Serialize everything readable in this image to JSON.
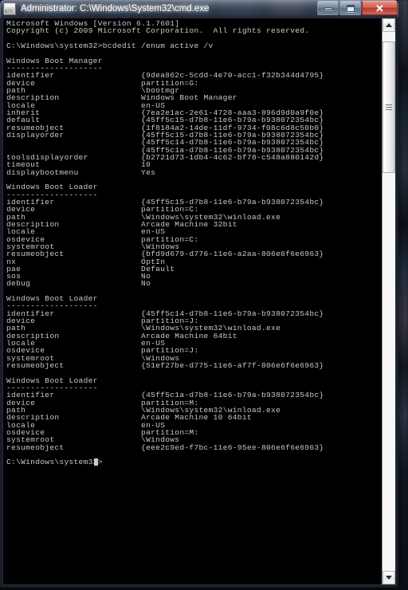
{
  "window": {
    "title": "Administrator: C:\\Windows\\System32\\cmd.exe",
    "icon": "cmd-console-icon",
    "buttons": {
      "minimize": "Minimize",
      "maximize": "Maximize",
      "close": "Close",
      "close_glyph": "✕"
    }
  },
  "colors": {
    "console_background": "#000000",
    "console_foreground": "#c8c8c8",
    "close_button": "#b53a2c",
    "title_text": "#ffffff"
  },
  "console": {
    "header_lines": [
      "Microsoft Windows [Version 6.1.7601]",
      "Copyright (c) 2009 Microsoft Corporation.  All rights reserved."
    ],
    "prompt": "C:\\Windows\\system32>",
    "command": "bcdedit /enum active /v",
    "trailing_prompt": "C:\\Windows\\system32>",
    "sections": [
      {
        "heading": "Windows Boot Manager",
        "underline": "--------------------",
        "entries": [
          {
            "key": "identifier",
            "values": [
              "{9dea862c-5cdd-4e70-acc1-f32b344d4795}"
            ]
          },
          {
            "key": "device",
            "values": [
              "partition=G:"
            ]
          },
          {
            "key": "path",
            "values": [
              "\\bootmgr"
            ]
          },
          {
            "key": "description",
            "values": [
              "Windows Boot Manager"
            ]
          },
          {
            "key": "locale",
            "values": [
              "en-US"
            ]
          },
          {
            "key": "inherit",
            "values": [
              "{7ea2e1ac-2e61-4728-aaa3-896d9d0a9f0e}"
            ]
          },
          {
            "key": "default",
            "values": [
              "{45ff5c15-d7b8-11e6-b79a-b938072354bc}"
            ]
          },
          {
            "key": "resumeobject",
            "values": [
              "{1f8184a2-14de-11df-9734-f08c6d8c50b0}"
            ]
          },
          {
            "key": "displayorder",
            "values": [
              "{45ff5c15-d7b8-11e6-b79a-b938072354bc}",
              "{45ff5c14-d7b8-11e6-b79a-b938072354bc}",
              "{45ff5c1a-d7b8-11e6-b79a-b938072354bc}"
            ]
          },
          {
            "key": "toolsdisplayorder",
            "values": [
              "{b2721d73-1db4-4c62-bf78-c548a880142d}"
            ]
          },
          {
            "key": "timeout",
            "values": [
              "10"
            ]
          },
          {
            "key": "displaybootmenu",
            "values": [
              "Yes"
            ]
          }
        ]
      },
      {
        "heading": "Windows Boot Loader",
        "underline": "-------------------",
        "entries": [
          {
            "key": "identifier",
            "values": [
              "{45ff5c15-d7b8-11e6-b79a-b938072354bc}"
            ]
          },
          {
            "key": "device",
            "values": [
              "partition=C:"
            ]
          },
          {
            "key": "path",
            "values": [
              "\\Windows\\system32\\winload.exe"
            ]
          },
          {
            "key": "description",
            "values": [
              "Arcade Machine 32bit"
            ]
          },
          {
            "key": "locale",
            "values": [
              "en-US"
            ]
          },
          {
            "key": "osdevice",
            "values": [
              "partition=C:"
            ]
          },
          {
            "key": "systemroot",
            "values": [
              "\\Windows"
            ]
          },
          {
            "key": "resumeobject",
            "values": [
              "{bfd9d679-d776-11e6-a2aa-806e6f6e6963}"
            ]
          },
          {
            "key": "nx",
            "values": [
              "OptIn"
            ]
          },
          {
            "key": "pae",
            "values": [
              "Default"
            ]
          },
          {
            "key": "sos",
            "values": [
              "No"
            ]
          },
          {
            "key": "debug",
            "values": [
              "No"
            ]
          }
        ]
      },
      {
        "heading": "Windows Boot Loader",
        "underline": "-------------------",
        "entries": [
          {
            "key": "identifier",
            "values": [
              "{45ff5c14-d7b8-11e6-b79a-b938072354bc}"
            ]
          },
          {
            "key": "device",
            "values": [
              "partition=J:"
            ]
          },
          {
            "key": "path",
            "values": [
              "\\Windows\\system32\\winload.exe"
            ]
          },
          {
            "key": "description",
            "values": [
              "Arcade Machine 64bit"
            ]
          },
          {
            "key": "locale",
            "values": [
              "en-US"
            ]
          },
          {
            "key": "osdevice",
            "values": [
              "partition=J:"
            ]
          },
          {
            "key": "systemroot",
            "values": [
              "\\Windows"
            ]
          },
          {
            "key": "resumeobject",
            "values": [
              "{51ef27be-d775-11e6-af7f-806e6f6e6963}"
            ]
          }
        ]
      },
      {
        "heading": "Windows Boot Loader",
        "underline": "-------------------",
        "entries": [
          {
            "key": "identifier",
            "values": [
              "{45ff5c1a-d7b8-11e6-b79a-b938072354bc}"
            ]
          },
          {
            "key": "device",
            "values": [
              "partition=M:"
            ]
          },
          {
            "key": "path",
            "values": [
              "\\Windows\\system32\\winload.exe"
            ]
          },
          {
            "key": "description",
            "values": [
              "Arcade Machine 10 64bit"
            ]
          },
          {
            "key": "locale",
            "values": [
              "en-US"
            ]
          },
          {
            "key": "osdevice",
            "values": [
              "partition=M:"
            ]
          },
          {
            "key": "systemroot",
            "values": [
              "\\Windows"
            ]
          },
          {
            "key": "resumeobject",
            "values": [
              "{eee2c9ed-f7bc-11e6-95ee-806e6f6e6963}"
            ]
          }
        ]
      }
    ]
  },
  "scrollbar": {
    "up_arrow": "▲",
    "down_arrow": "▼",
    "thumb": "scroll-thumb"
  }
}
